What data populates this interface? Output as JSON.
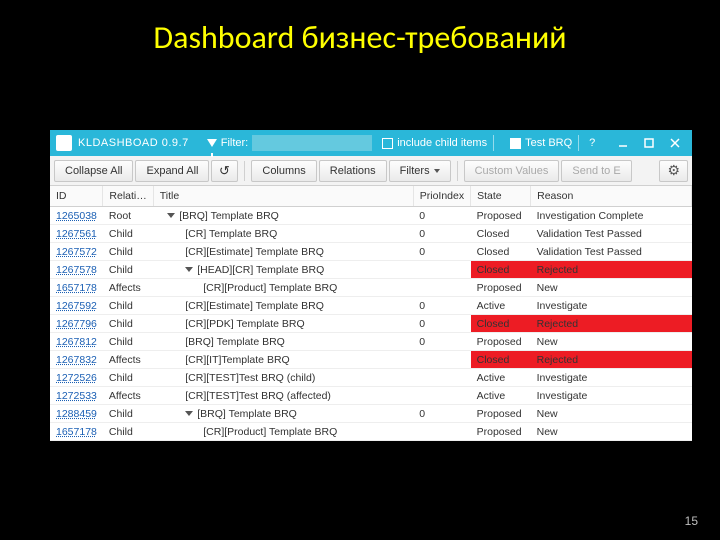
{
  "slide": {
    "title": "Dashboard бизнес-требований",
    "page_number": "15"
  },
  "app": {
    "title": "KLDASHBOAD 0.9.7",
    "filter_label": "Filter:",
    "filter_value": "",
    "include_children_label": "include child items",
    "test_brq_label": "Test BRQ",
    "help_label": "?"
  },
  "toolbar": {
    "collapse_all": "Collapse All",
    "expand_all": "Expand All",
    "columns": "Columns",
    "relations": "Relations",
    "filters": "Filters",
    "custom_values": "Custom Values",
    "send_to": "Send to E"
  },
  "columns": {
    "id": "ID",
    "relation": "Relati…",
    "title": "Title",
    "prio": "PrioIndex",
    "state": "State",
    "reason": "Reason"
  },
  "rows": [
    {
      "id": "1265038",
      "relation": "Root",
      "indent": 0,
      "toggle": true,
      "title": "[BRQ] Template BRQ",
      "prio": "0",
      "state": "Proposed",
      "reason": "Investigation Complete",
      "danger": false
    },
    {
      "id": "1267561",
      "relation": "Child",
      "indent": 1,
      "toggle": false,
      "title": "[CR] Template BRQ",
      "prio": "0",
      "state": "Closed",
      "reason": "Validation Test Passed",
      "danger": false
    },
    {
      "id": "1267572",
      "relation": "Child",
      "indent": 1,
      "toggle": false,
      "title": "[CR][Estimate] Template BRQ",
      "prio": "0",
      "state": "Closed",
      "reason": "Validation Test Passed",
      "danger": false
    },
    {
      "id": "1267578",
      "relation": "Child",
      "indent": 1,
      "toggle": true,
      "title": "[HEAD][CR] Template BRQ",
      "prio": "",
      "state": "Closed",
      "reason": "Rejected",
      "danger": true
    },
    {
      "id": "1657178",
      "relation": "Affects",
      "indent": 2,
      "toggle": false,
      "title": "[CR][Product] Template BRQ",
      "prio": "",
      "state": "Proposed",
      "reason": "New",
      "danger": false
    },
    {
      "id": "1267592",
      "relation": "Child",
      "indent": 1,
      "toggle": false,
      "title": "[CR][Estimate] Template BRQ",
      "prio": "0",
      "state": "Active",
      "reason": "Investigate",
      "danger": false
    },
    {
      "id": "1267796",
      "relation": "Child",
      "indent": 1,
      "toggle": false,
      "title": "[CR][PDK] Template BRQ",
      "prio": "0",
      "state": "Closed",
      "reason": "Rejected",
      "danger": true
    },
    {
      "id": "1267812",
      "relation": "Child",
      "indent": 1,
      "toggle": false,
      "title": "[BRQ] Template BRQ",
      "prio": "0",
      "state": "Proposed",
      "reason": "New",
      "danger": false
    },
    {
      "id": "1267832",
      "relation": "Affects",
      "indent": 1,
      "toggle": false,
      "title": "[CR][IT]Template BRQ",
      "prio": "",
      "state": "Closed",
      "reason": "Rejected",
      "danger": true
    },
    {
      "id": "1272526",
      "relation": "Child",
      "indent": 1,
      "toggle": false,
      "title": "[CR][TEST]Test BRQ (child)",
      "prio": "",
      "state": "Active",
      "reason": "Investigate",
      "danger": false
    },
    {
      "id": "1272533",
      "relation": "Affects",
      "indent": 1,
      "toggle": false,
      "title": "[CR][TEST]Test BRQ (affected)",
      "prio": "",
      "state": "Active",
      "reason": "Investigate",
      "danger": false
    },
    {
      "id": "1288459",
      "relation": "Child",
      "indent": 1,
      "toggle": true,
      "title": "[BRQ] Template BRQ",
      "prio": "0",
      "state": "Proposed",
      "reason": "New",
      "danger": false
    },
    {
      "id": "1657178",
      "relation": "Child",
      "indent": 2,
      "toggle": false,
      "title": "[CR][Product] Template BRQ",
      "prio": "",
      "state": "Proposed",
      "reason": "New",
      "danger": false
    }
  ]
}
